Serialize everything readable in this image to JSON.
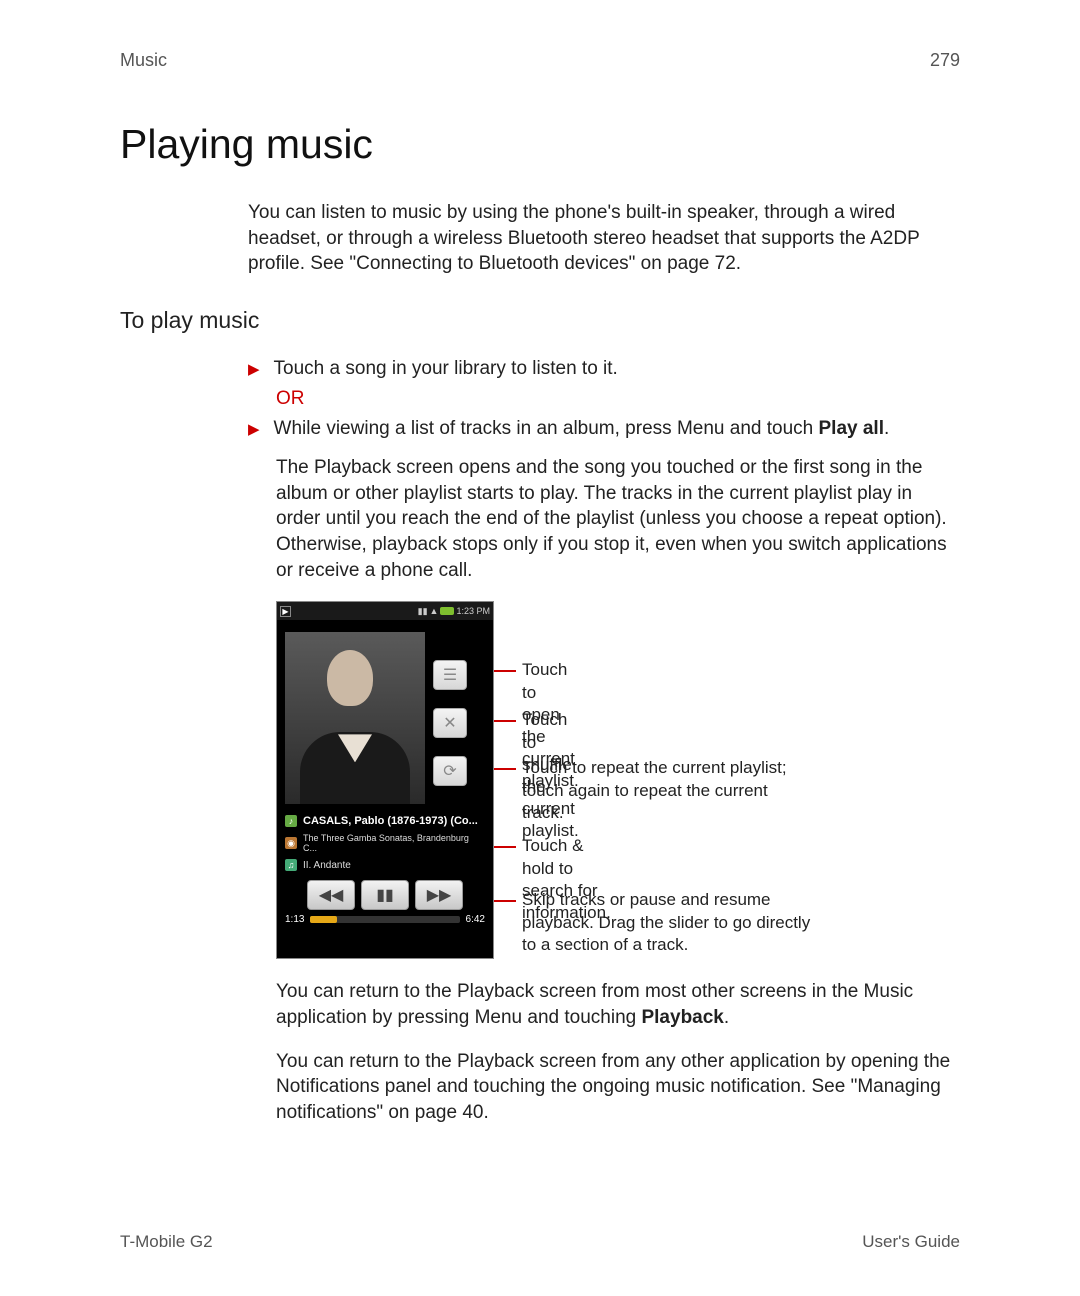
{
  "header": {
    "section": "Music",
    "page_number": "279"
  },
  "title": "Playing music",
  "intro": "You can listen to music by using the phone's built-in speaker, through a wired headset, or through a wireless Bluetooth stereo headset that supports the A2DP profile. See \"Connecting to Bluetooth devices\" on page 72.",
  "subhead": "To play music",
  "steps": {
    "step1": "Touch a song in your library to listen to it.",
    "or": "OR",
    "step2_prefix": "While viewing a list of tracks in an album, press ",
    "step2_menu": "Menu",
    "step2_mid": " and touch ",
    "step2_bold": "Play all",
    "step2_suffix": "."
  },
  "body1": "The Playback screen opens and the song you touched or the first song in the album or other playlist starts to play. The tracks in the current playlist play in order until you reach the end of the playlist (unless you choose a repeat option). Otherwise, playback stops only if you stop it, even when you switch applications or receive a phone call.",
  "phone": {
    "time": "1:23 PM",
    "artist": "CASALS, Pablo (1876-1973) (Co...",
    "album": "The Three Gamba Sonatas, Brandenburg C...",
    "track": "II. Andante",
    "elapsed": "1:13",
    "total": "6:42"
  },
  "annotations": {
    "a1": "Touch to open the current playlist.",
    "a2": "Touch to shuffle the current playlist.",
    "a3": "Touch to repeat the current playlist; touch again to repeat the current track.",
    "a4": "Touch & hold to search for information.",
    "a5": "Skip tracks or pause and resume playback. Drag the slider to go directly to a section of a track."
  },
  "body2_prefix": "You can return to the Playback screen from most other screens in the Music application by pressing ",
  "body2_menu": "Menu",
  "body2_mid": " and touching ",
  "body2_bold": "Playback",
  "body2_suffix": ".",
  "body3": "You can return to the Playback screen from any other application by opening the Notifications panel and touching the ongoing music notification. See \"Managing notifications\" on page 40.",
  "footer": {
    "left": "T-Mobile G2",
    "right": "User's Guide"
  }
}
